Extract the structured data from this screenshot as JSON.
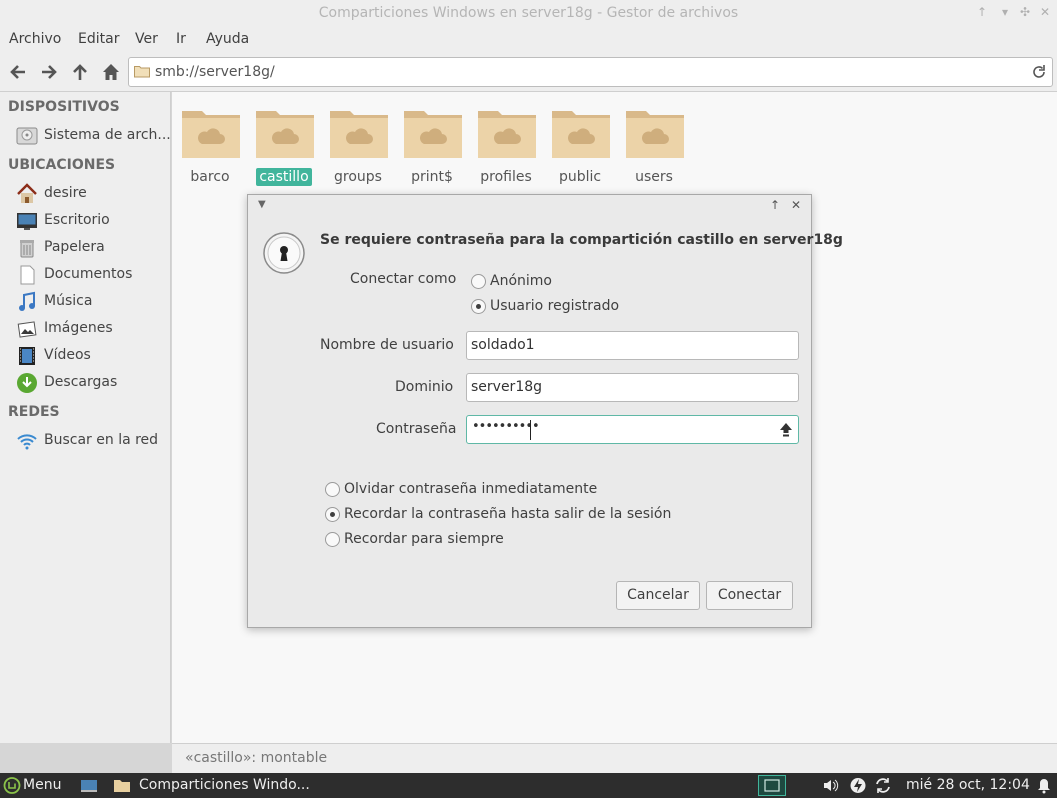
{
  "window": {
    "title": "Comparticiones Windows en server18g - Gestor de archivos"
  },
  "menu": [
    "Archivo",
    "Editar",
    "Ver",
    "Ir",
    "Ayuda"
  ],
  "location": {
    "path": "smb://server18g/"
  },
  "sidebar": {
    "devices_header": "DISPOSITIVOS",
    "devices": [
      {
        "label": "Sistema de arch...",
        "icon": "drive-icon"
      }
    ],
    "places_header": "UBICACIONES",
    "places": [
      {
        "label": "desire",
        "icon": "home-icon"
      },
      {
        "label": "Escritorio",
        "icon": "desktop-icon"
      },
      {
        "label": "Papelera",
        "icon": "trash-icon"
      },
      {
        "label": "Documentos",
        "icon": "document-icon"
      },
      {
        "label": "Música",
        "icon": "music-icon"
      },
      {
        "label": "Imágenes",
        "icon": "pictures-icon"
      },
      {
        "label": "Vídeos",
        "icon": "video-icon"
      },
      {
        "label": "Descargas",
        "icon": "download-icon"
      }
    ],
    "network_header": "REDES",
    "network": [
      {
        "label": "Buscar en la red",
        "icon": "network-icon"
      }
    ]
  },
  "shares": [
    {
      "label": "barco",
      "selected": false
    },
    {
      "label": "castillo",
      "selected": true
    },
    {
      "label": "groups",
      "selected": false
    },
    {
      "label": "print$",
      "selected": false
    },
    {
      "label": "profiles",
      "selected": false
    },
    {
      "label": "public",
      "selected": false
    },
    {
      "label": "users",
      "selected": false
    }
  ],
  "status": "«castillo»: montable",
  "dialog": {
    "heading": "Se requiere contraseña para la compartición castillo en server18g",
    "connect_as_label": "Conectar como",
    "anon_label": "Anónimo",
    "registered_label": "Usuario registrado",
    "connect_as_selected": "Usuario registrado",
    "username_label": "Nombre de usuario",
    "username_value": "soldado1",
    "domain_label": "Dominio",
    "domain_value": "server18g",
    "password_label": "Contraseña",
    "password_mask": "••••••••••",
    "remember_options": [
      "Olvidar contraseña inmediatamente",
      "Recordar la contraseña hasta salir de la sesión",
      "Recordar para siempre"
    ],
    "remember_selected": "Recordar la contraseña hasta salir de la sesión",
    "cancel_label": "Cancelar",
    "connect_label": "Conectar"
  },
  "taskbar": {
    "menu_label": "Menu",
    "task_label": "Comparticiones Windo...",
    "clock": "mié 28 oct, 12:04"
  },
  "colors": {
    "accent": "#41b59c",
    "folder": "#e8cfa3",
    "taskbar": "#2d2d2d"
  }
}
